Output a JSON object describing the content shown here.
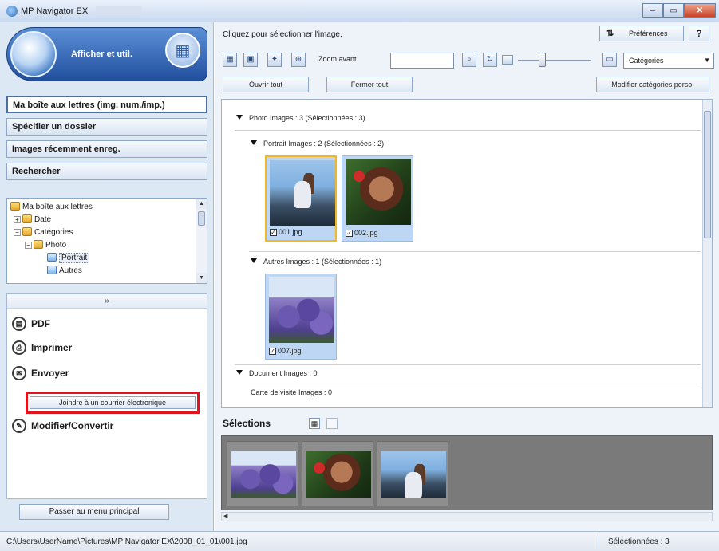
{
  "window": {
    "title": "MP Navigator EX",
    "controls": [
      "minimize",
      "maximize",
      "close"
    ]
  },
  "sidebar": {
    "banner_label": "Afficher et util.",
    "nav": [
      {
        "label": "Ma boîte aux lettres (img. num./imp.)",
        "active": true
      },
      {
        "label": "Spécifier un dossier",
        "active": false
      },
      {
        "label": "Images récemment enreg.",
        "active": false
      },
      {
        "label": "Rechercher",
        "active": false
      }
    ],
    "tree": [
      {
        "label": "Ma boîte aux lettres",
        "level": 0,
        "icon": "mailbox-icon"
      },
      {
        "label": "Date",
        "level": 1,
        "icon": "folder-icon",
        "toggle": "+"
      },
      {
        "label": "Catégories",
        "level": 1,
        "icon": "folder-icon",
        "toggle": "-"
      },
      {
        "label": "Photo",
        "level": 2,
        "icon": "folder-icon",
        "toggle": "-"
      },
      {
        "label": "Portrait",
        "level": 3,
        "icon": "picture-folder-icon",
        "selected": true
      },
      {
        "label": "Autres",
        "level": 3,
        "icon": "picture-folder-icon"
      }
    ],
    "expander": "»",
    "actions": [
      {
        "label": "PDF",
        "icon": "pdf-icon"
      },
      {
        "label": "Imprimer",
        "icon": "printer-icon"
      },
      {
        "label": "Envoyer",
        "icon": "mail-icon"
      },
      {
        "label": "Modifier/Convertir",
        "icon": "pen-icon"
      }
    ],
    "attach_button": "Joindre à un courrier électronique",
    "main_menu_button": "Passer au menu principal"
  },
  "header": {
    "instruction": "Cliquez pour sélectionner l'image.",
    "preferences": "Préférences",
    "help": "?"
  },
  "toolbar": {
    "zoom_label": "Zoom avant",
    "search_value": "",
    "sort_select": "Catégories"
  },
  "controls": {
    "open_all": "Ouvrir tout",
    "close_all": "Fermer tout",
    "edit_categories": "Modifier catégories perso."
  },
  "groups": {
    "photo": "Photo   Images : 3   (Sélectionnées : 3)",
    "portrait": "Portrait   Images : 2   (Sélectionnées : 2)",
    "autres": "Autres   Images : 1   (Sélectionnées : 1)",
    "document": "Document   Images : 0",
    "carte": "Carte de visite   Images : 0"
  },
  "images": [
    {
      "name": "001.jpg",
      "checked": true,
      "selected_frame": true,
      "scene": "beach"
    },
    {
      "name": "002.jpg",
      "checked": true,
      "selected_frame": false,
      "scene": "portrait"
    },
    {
      "name": "007.jpg",
      "checked": true,
      "selected_frame": false,
      "scene": "flowers"
    }
  ],
  "selections": {
    "label": "Sélections",
    "tray": [
      "flowers",
      "portrait",
      "beach"
    ]
  },
  "status": {
    "path": "C:\\Users\\UserName\\Pictures\\MP Navigator EX\\2008_01_01\\001.jpg",
    "selected_count": "Sélectionnées : 3"
  },
  "colors": {
    "highlight_box": "#e0141a",
    "selected_frame": "#f1b72b",
    "panel_bg": "#dde8f5"
  }
}
